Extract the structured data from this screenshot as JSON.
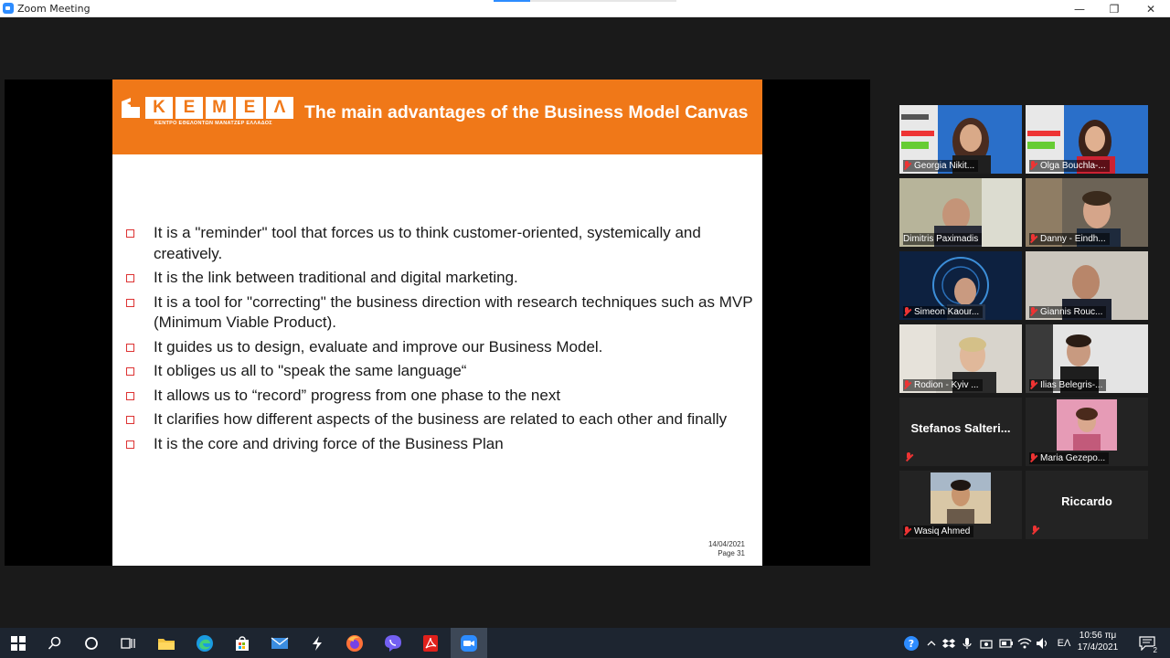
{
  "window": {
    "title": "Zoom Meeting",
    "minimize": "—",
    "restore": "❐",
    "close": "✕"
  },
  "slide": {
    "brand_letters": [
      "K",
      "E",
      "M",
      "E",
      "Λ"
    ],
    "brand_tagline": "ΚΕΝΤΡΟ ΕΘΕΛΟΝΤΩΝ ΜΑΝΑΤΖΕΡ ΕΛΛΑΔΟΣ",
    "title": "The main advantages of the Business Model Canvas",
    "bullets": [
      "It is a \"reminder\" tool that forces us to think customer-oriented, systemically and creatively.",
      "It is the link between traditional and digital marketing.",
      "It is a tool for \"correcting\" the business direction with research techniques such as MVP (Minimum Viable Product).",
      "It guides us to design, evaluate and improve our Business Model.",
      "It obliges us all to \"speak the same language“",
      "It allows us to “record” progress from one phase to the next",
      "It clarifies how different aspects of the business are related to each other and finally",
      "It is the core and driving force of the Business Plan"
    ],
    "footer_date": "14/04/2021",
    "footer_page": "Page  31",
    "accent_color": "#f07818"
  },
  "participants": [
    {
      "name": "Georgia Nikit...",
      "muted": true,
      "video": true
    },
    {
      "name": "Olga Bouchla-...",
      "muted": true,
      "video": true
    },
    {
      "name": "Dimitris Paximadis",
      "muted": false,
      "video": true,
      "active_speaker": true
    },
    {
      "name": "Danny - Eindh...",
      "muted": true,
      "video": true
    },
    {
      "name": "Simeon Kaour...",
      "muted": true,
      "video": true
    },
    {
      "name": "Giannis Rouc...",
      "muted": true,
      "video": true
    },
    {
      "name": "Rodion - Kyiv ...",
      "muted": true,
      "video": true
    },
    {
      "name": "Ilias Belegris-...",
      "muted": true,
      "video": true
    },
    {
      "name": "Stefanos  Salteri...",
      "muted": true,
      "video": false
    },
    {
      "name": "Maria Gezepo...",
      "muted": true,
      "video": true
    },
    {
      "name": "Wasiq Ahmed",
      "muted": true,
      "video": true
    },
    {
      "name": "Riccardo",
      "muted": true,
      "video": false
    }
  ],
  "taskbar": {
    "language": "ΕΛ",
    "time": "10:56 πμ",
    "date": "17/4/2021",
    "notifications": "2"
  }
}
